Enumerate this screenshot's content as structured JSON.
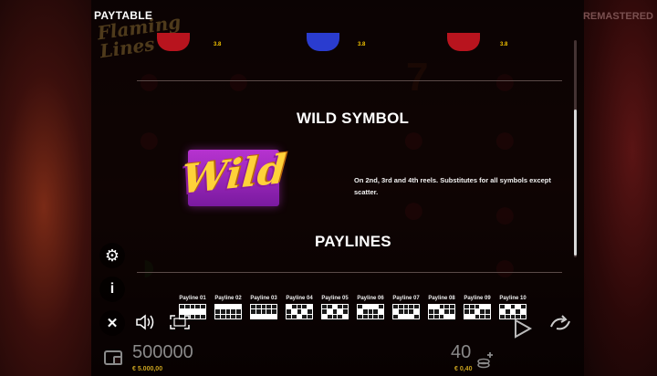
{
  "header": {
    "title": "PAYTABLE",
    "remastered_label": "REMASTERED"
  },
  "symbol_values": [
    "3.8",
    "3.8",
    "3.8"
  ],
  "wild": {
    "section_title": "WILD SYMBOL",
    "badge_text": "Wild",
    "description": "On 2nd, 3rd and 4th reels. Substitutes for all symbols except scatter."
  },
  "paylines": {
    "section_title": "PAYLINES",
    "items": [
      {
        "label": "Payline 01",
        "grid": [
          0,
          0,
          0,
          0,
          0,
          1,
          1,
          1,
          1,
          1,
          0,
          0,
          0,
          0,
          0
        ]
      },
      {
        "label": "Payline 02",
        "grid": [
          1,
          1,
          1,
          1,
          1,
          0,
          0,
          0,
          0,
          0,
          0,
          0,
          0,
          0,
          0
        ]
      },
      {
        "label": "Payline 03",
        "grid": [
          0,
          0,
          0,
          0,
          0,
          0,
          0,
          0,
          0,
          0,
          1,
          1,
          1,
          1,
          1
        ]
      },
      {
        "label": "Payline 04",
        "grid": [
          1,
          0,
          0,
          0,
          1,
          0,
          1,
          0,
          1,
          0,
          0,
          0,
          1,
          0,
          0
        ]
      },
      {
        "label": "Payline 05",
        "grid": [
          0,
          0,
          1,
          0,
          0,
          0,
          1,
          0,
          1,
          0,
          1,
          0,
          0,
          0,
          1
        ]
      },
      {
        "label": "Payline 06",
        "grid": [
          0,
          1,
          1,
          1,
          0,
          1,
          0,
          0,
          0,
          1,
          0,
          0,
          0,
          0,
          0
        ]
      },
      {
        "label": "Payline 07",
        "grid": [
          0,
          0,
          0,
          0,
          0,
          1,
          0,
          0,
          0,
          1,
          0,
          1,
          1,
          1,
          0
        ]
      },
      {
        "label": "Payline 08",
        "grid": [
          1,
          1,
          0,
          0,
          0,
          0,
          0,
          1,
          0,
          0,
          0,
          0,
          0,
          1,
          1
        ]
      },
      {
        "label": "Payline 09",
        "grid": [
          0,
          0,
          0,
          1,
          1,
          0,
          0,
          1,
          0,
          0,
          1,
          1,
          0,
          0,
          0
        ]
      },
      {
        "label": "Payline 10",
        "grid": [
          0,
          1,
          0,
          1,
          0,
          1,
          0,
          1,
          0,
          1,
          0,
          0,
          0,
          0,
          0
        ]
      }
    ]
  },
  "controls": {
    "settings_icon": "gear-icon",
    "info_label": "i",
    "close_label": "✕",
    "sound_icon": "speaker-icon",
    "fullscreen_icon": "fullscreen-icon"
  },
  "footer": {
    "balance_credits": "500000",
    "balance_money": "€ 5.000,00",
    "bet_credits": "40",
    "bet_money": "€ 0,40"
  },
  "colors": {
    "gold": "#f2c200",
    "wild_purple": "#b733d0",
    "wild_yellow": "#ffd23a"
  }
}
